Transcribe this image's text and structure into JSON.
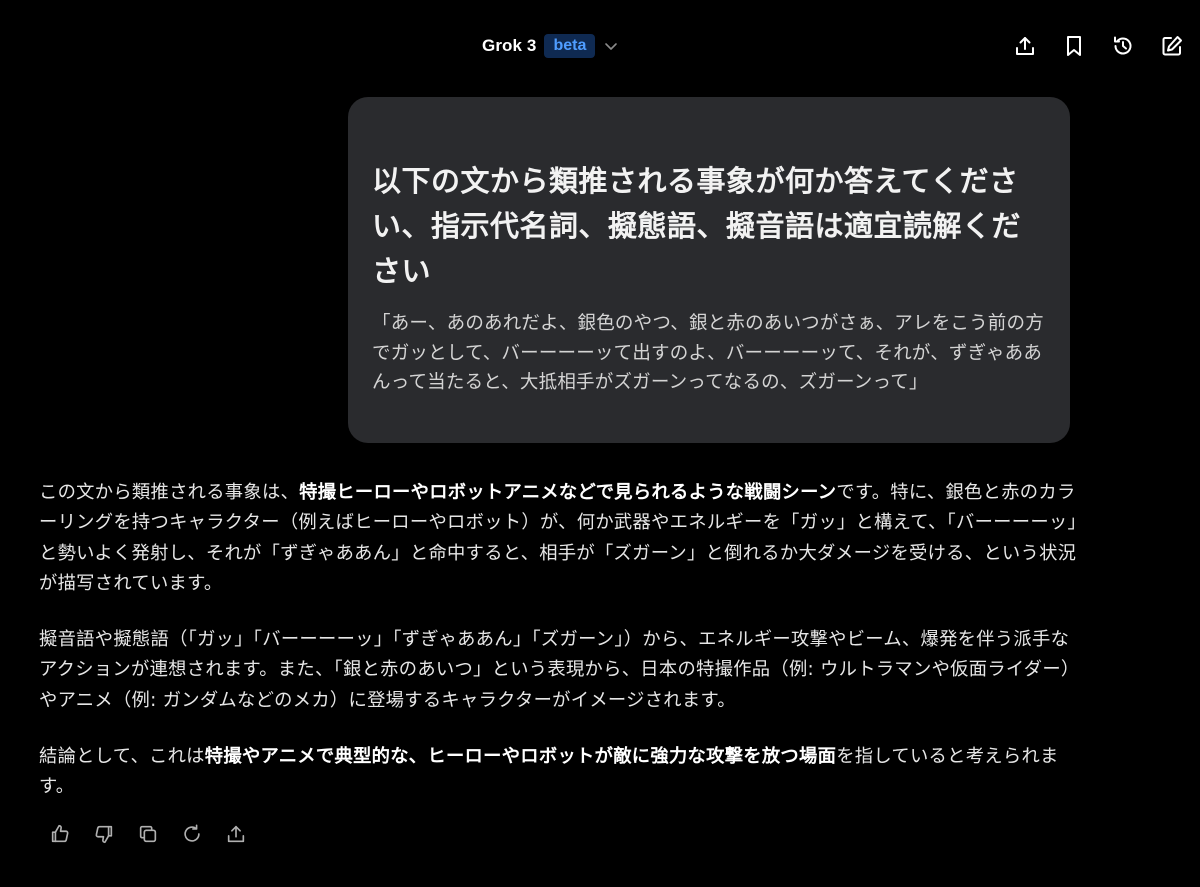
{
  "header": {
    "model_name": "Grok 3",
    "badge": "beta",
    "icons": [
      "share-icon",
      "bookmark-icon",
      "history-icon",
      "edit-icon"
    ]
  },
  "user_message": {
    "heading": "以下の文から類推される事象が何か答えてください、指示代名詞、擬態語、擬音語は適宜読解ください",
    "quote": "「あー、あのあれだよ、銀色のやつ、銀と赤のあいつがさぁ、アレをこう前の方でガッとして、バーーーーッて出すのよ、バーーーーッて、それが、ずぎゃああんって当たると、大抵相手がズガーンってなるの、ズガーンって」"
  },
  "response": {
    "p1_a": "この文から類推される事象は、",
    "p1_b": "特撮ヒーローやロボットアニメなどで見られるような戦闘シーン",
    "p1_c": "です。特に、銀色と赤のカラーリングを持つキャラクター（例えばヒーローやロボット）が、何か武器やエネルギーを「ガッ」と構えて、「バーーーーッ」と勢いよく発射し、それが「ずぎゃああん」と命中すると、相手が「ズガーン」と倒れるか大ダメージを受ける、という状況が描写されています。",
    "p2": "擬音語や擬態語（「ガッ」「バーーーーッ」「ずぎゃああん」「ズガーン」）から、エネルギー攻撃やビーム、爆発を伴う派手なアクションが連想されます。また、「銀と赤のあいつ」という表現から、日本の特撮作品（例: ウルトラマンや仮面ライダー）やアニメ（例: ガンダムなどのメカ）に登場するキャラクターがイメージされます。",
    "p3_a": "結論として、これは",
    "p3_b": "特撮やアニメで典型的な、ヒーローやロボットが敵に強力な攻撃を放つ場面",
    "p3_c": "を指していると考えられます。"
  },
  "actions": [
    "thumbs-up-icon",
    "thumbs-down-icon",
    "copy-icon",
    "regenerate-icon",
    "share-icon"
  ],
  "colors": {
    "background": "#000000",
    "bubble": "#2a2b2e",
    "badge_bg": "#0f2a52",
    "badge_text": "#4f9dff"
  }
}
